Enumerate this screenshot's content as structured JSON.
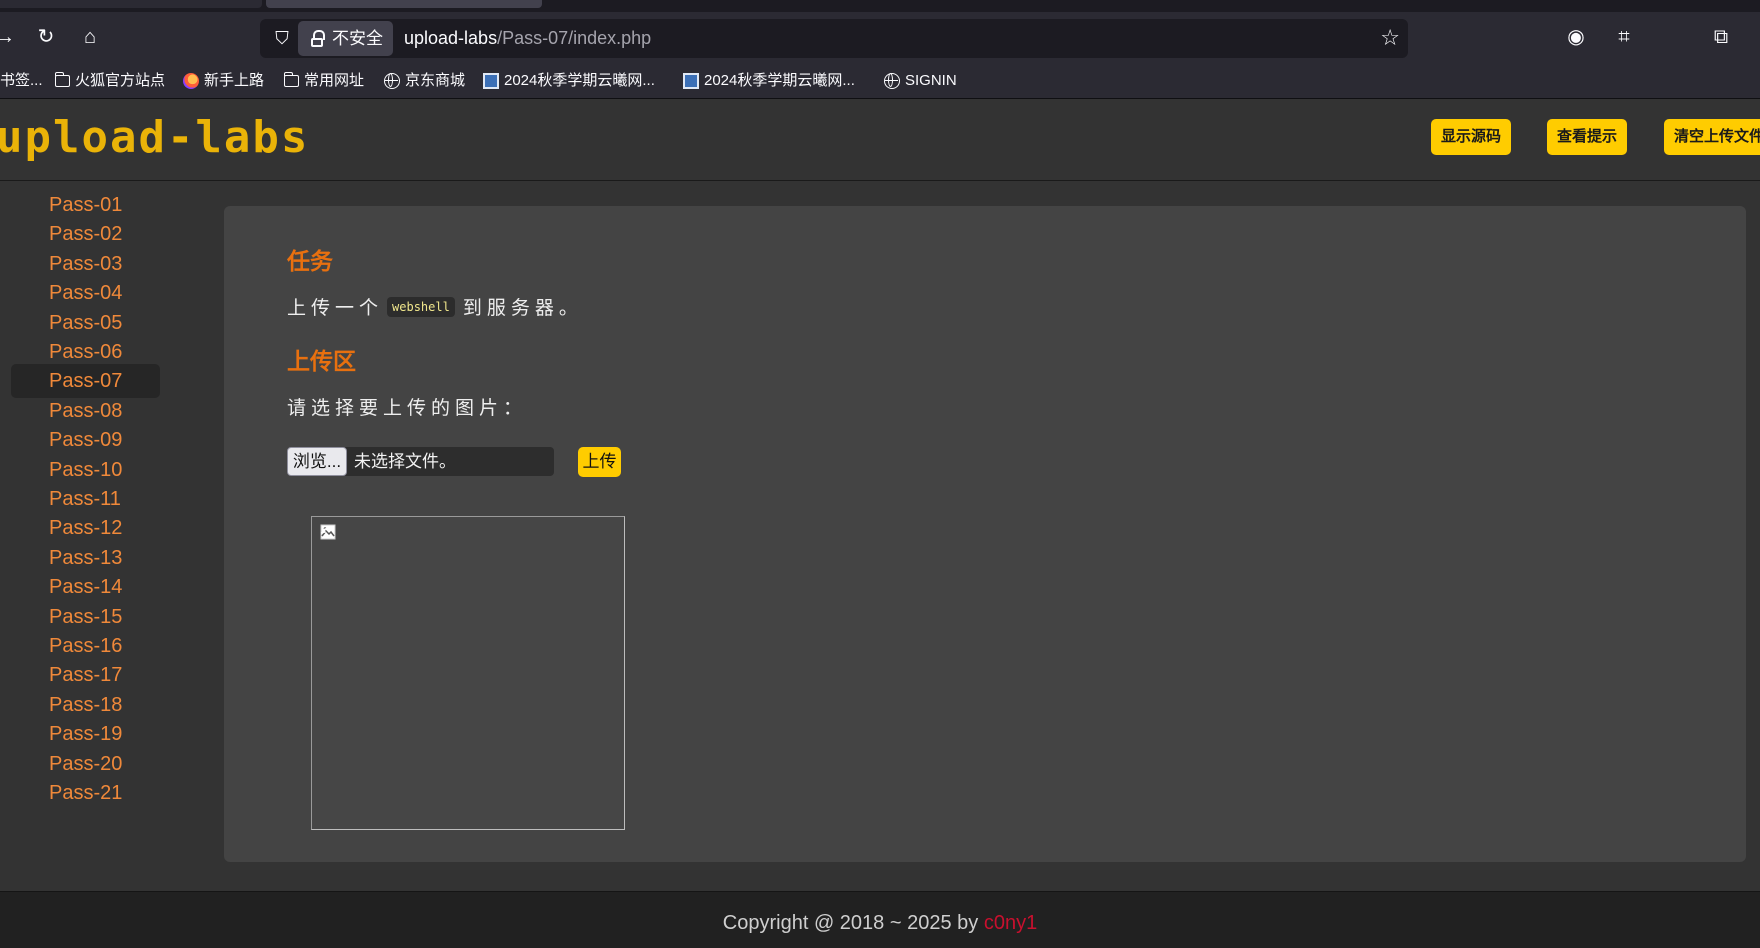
{
  "browser": {
    "url_security_label": "不安全",
    "url_host": "upload-labs",
    "url_path": "/Pass-07/index.php"
  },
  "bookmarks": [
    {
      "label": "书签...",
      "icon": "none"
    },
    {
      "label": "火狐官方站点",
      "icon": "folder-icon"
    },
    {
      "label": "新手上路",
      "icon": "firefox-icon"
    },
    {
      "label": "常用网址",
      "icon": "folder-icon"
    },
    {
      "label": "京东商城",
      "icon": "globe-icon"
    },
    {
      "label": "2024秋季学期云曦网...",
      "icon": "site-favicon"
    },
    {
      "label": "2024秋季学期云曦网...",
      "icon": "site-favicon"
    },
    {
      "label": "SIGNIN",
      "icon": "globe-icon"
    }
  ],
  "header": {
    "logo_text": "upload-labs",
    "buttons": [
      "显示源码",
      "查看提示",
      "清空上传文件"
    ]
  },
  "sidebar": {
    "active": "Pass-07",
    "items": [
      "Pass-01",
      "Pass-02",
      "Pass-03",
      "Pass-04",
      "Pass-05",
      "Pass-06",
      "Pass-07",
      "Pass-08",
      "Pass-09",
      "Pass-10",
      "Pass-11",
      "Pass-12",
      "Pass-13",
      "Pass-14",
      "Pass-15",
      "Pass-16",
      "Pass-17",
      "Pass-18",
      "Pass-19",
      "Pass-20",
      "Pass-21"
    ]
  },
  "main": {
    "task_heading": "任务",
    "task_before": "上传一个",
    "task_code": "webshell",
    "task_after": "到服务器。",
    "upload_heading": "上传区",
    "choose_prompt": "请选择要上传的图片：",
    "browse_label": "浏览...",
    "no_file_label": "未选择文件。",
    "upload_label": "上传"
  },
  "footer": {
    "copyright_prefix": "Copyright @ 2018 ~ 2025 by ",
    "author": "c0ny1"
  },
  "colors": {
    "accent_orange": "#e8700f",
    "button_yellow": "#ffcc00",
    "author_red": "#c8102e"
  }
}
